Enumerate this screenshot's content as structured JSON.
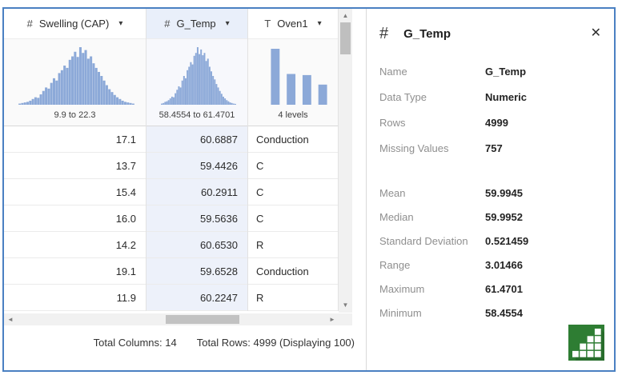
{
  "icons": {
    "numeric_type": "#",
    "text_type": "T",
    "dropdown": "▾",
    "close": "✕",
    "scroll_up": "▲",
    "scroll_down": "▼",
    "scroll_left": "◄",
    "scroll_right": "►"
  },
  "colors": {
    "window_border": "#4a80c2",
    "histogram": "#8ca9d8",
    "selected_column_bg": "#edf1fa",
    "panel_icon_green": "#2e7d33"
  },
  "grid": {
    "columns": [
      {
        "type": "numeric",
        "name": "Swelling (CAP)",
        "summary": "9.9 to 22.3",
        "selected": false,
        "hist": [
          0.02,
          0.03,
          0.04,
          0.05,
          0.07,
          0.1,
          0.13,
          0.12,
          0.18,
          0.24,
          0.3,
          0.28,
          0.38,
          0.46,
          0.42,
          0.55,
          0.6,
          0.68,
          0.64,
          0.78,
          0.84,
          0.92,
          0.83,
          1.0,
          0.9,
          0.95,
          0.8,
          0.84,
          0.72,
          0.64,
          0.57,
          0.5,
          0.42,
          0.34,
          0.27,
          0.22,
          0.17,
          0.13,
          0.1,
          0.07,
          0.05,
          0.04,
          0.03,
          0.02
        ]
      },
      {
        "type": "numeric",
        "name": "G_Temp",
        "summary": "58.4554 to 61.4701",
        "selected": true,
        "hist": [
          0.02,
          0.03,
          0.05,
          0.06,
          0.08,
          0.11,
          0.14,
          0.13,
          0.2,
          0.26,
          0.32,
          0.3,
          0.42,
          0.5,
          0.46,
          0.6,
          0.66,
          0.74,
          0.7,
          0.85,
          0.9,
          1.0,
          0.88,
          0.96,
          0.86,
          0.9,
          0.76,
          0.8,
          0.66,
          0.58,
          0.5,
          0.44,
          0.36,
          0.3,
          0.24,
          0.19,
          0.14,
          0.11,
          0.08,
          0.06,
          0.04,
          0.03,
          0.02,
          0.015
        ]
      },
      {
        "type": "text",
        "name": "Oven1",
        "summary": "4 levels",
        "selected": false,
        "hist": [
          1.0,
          0.55,
          0.53,
          0.36
        ]
      }
    ],
    "rows": [
      [
        "17.1",
        "60.6887",
        "Conduction"
      ],
      [
        "13.7",
        "59.4426",
        "C"
      ],
      [
        "15.4",
        "60.2911",
        "C"
      ],
      [
        "16.0",
        "59.5636",
        "C"
      ],
      [
        "14.2",
        "60.6530",
        "R"
      ],
      [
        "19.1",
        "59.6528",
        "Conduction"
      ],
      [
        "11.9",
        "60.2247",
        "R"
      ]
    ],
    "status": {
      "total_columns": "Total Columns: 14",
      "total_rows": "Total Rows: 4999 (Displaying 100)"
    }
  },
  "panel": {
    "title": "G_Temp",
    "fields": [
      {
        "label": "Name",
        "value": "G_Temp"
      },
      {
        "label": "Data Type",
        "value": "Numeric"
      },
      {
        "label": "Rows",
        "value": "4999"
      },
      {
        "label": "Missing Values",
        "value": "757"
      }
    ],
    "fields2": [
      {
        "label": "Mean",
        "value": "59.9945"
      },
      {
        "label": "Median",
        "value": "59.9952"
      },
      {
        "label": "Standard Deviation",
        "value": "0.521459"
      },
      {
        "label": "Range",
        "value": "3.01466"
      },
      {
        "label": "Maximum",
        "value": "61.4701"
      },
      {
        "label": "Minimum",
        "value": "58.4554"
      }
    ]
  }
}
